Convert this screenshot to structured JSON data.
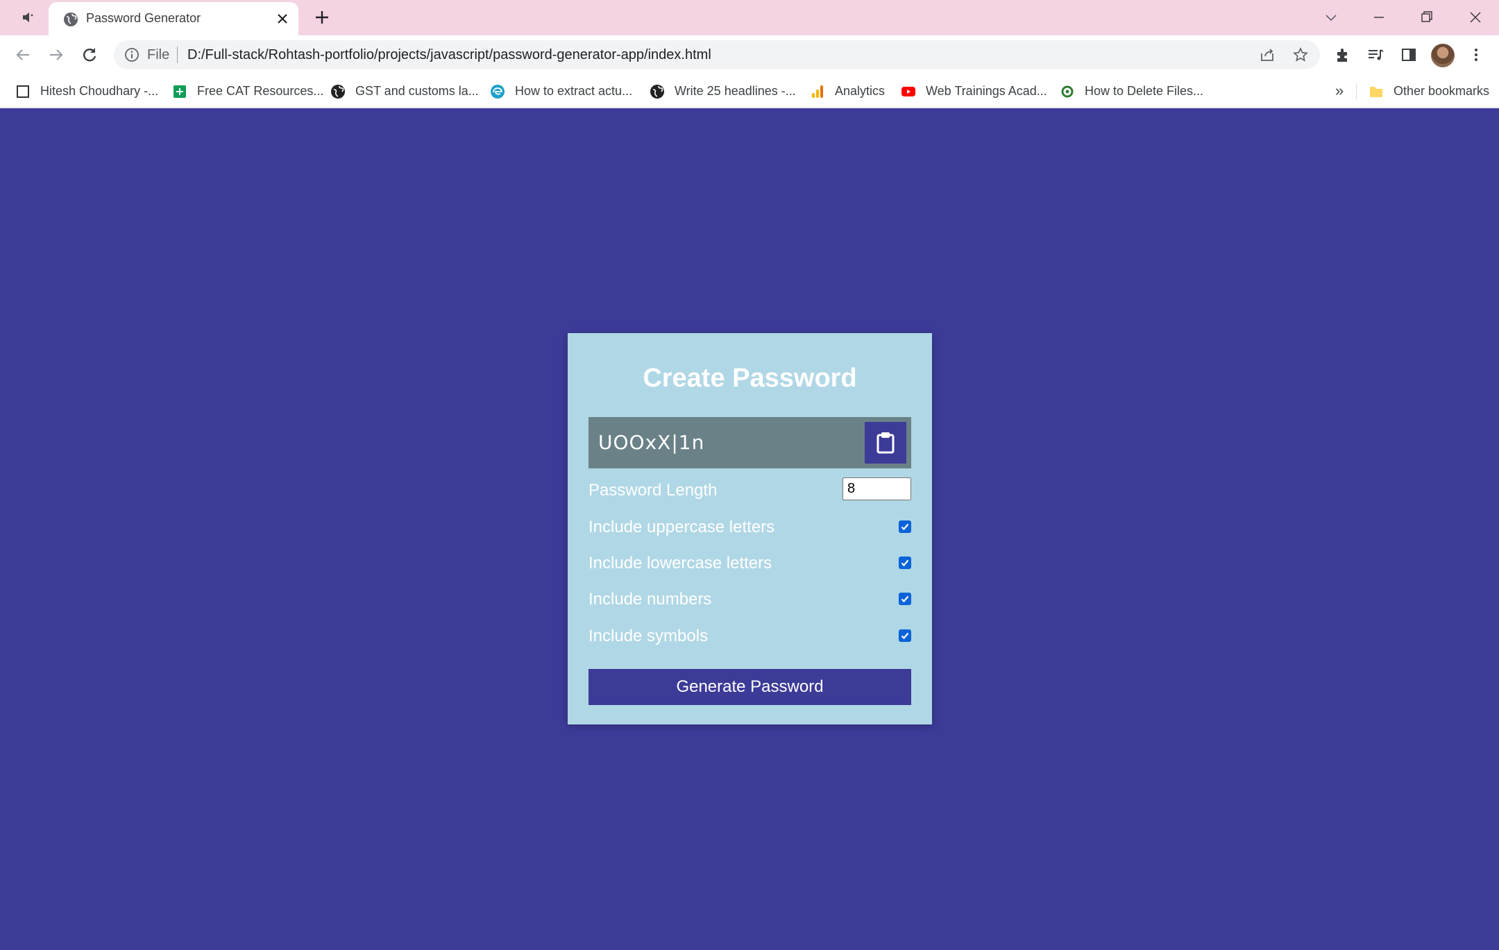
{
  "browser": {
    "tab": {
      "title": "Password Generator",
      "favicon": "globe-icon"
    },
    "omnibox": {
      "scheme_label": "File",
      "url": "D:/Full-stack/Rohtash-portfolio/projects/javascript/password-generator-app/index.html"
    },
    "bookmarks": [
      {
        "label": "Hitesh Choudhary -...",
        "icon": "page-icon"
      },
      {
        "label": "Free CAT Resources...",
        "icon": "sheets-icon"
      },
      {
        "label": "GST and customs la...",
        "icon": "globe-icon"
      },
      {
        "label": "How to extract actu...",
        "icon": "edge-icon"
      },
      {
        "label": "Write 25 headlines -...",
        "icon": "globe-icon"
      },
      {
        "label": "Analytics",
        "icon": "analytics-icon"
      },
      {
        "label": "Web Trainings Acad...",
        "icon": "youtube-icon"
      },
      {
        "label": "How to Delete Files...",
        "icon": "green-circle-icon"
      }
    ],
    "bookmarks_overflow": "»",
    "other_bookmarks": "Other bookmarks"
  },
  "app": {
    "title": "Create Password",
    "result": "UOOxX|1n",
    "settings": {
      "length_label": "Password Length",
      "length_value": "8",
      "uppercase_label": "Include uppercase letters",
      "lowercase_label": "Include lowercase letters",
      "numbers_label": "Include numbers",
      "symbols_label": "Include symbols"
    },
    "checkboxes": {
      "uppercase": true,
      "lowercase": true,
      "numbers": true,
      "symbols": true
    },
    "generate_label": "Generate Password"
  },
  "colors": {
    "page_background": "#3c3b98",
    "card_background": "#b0d7e5",
    "result_background": "#6a8287",
    "checkbox_accent": "#0b63d9",
    "tabstrip": "#f4d3e3"
  }
}
